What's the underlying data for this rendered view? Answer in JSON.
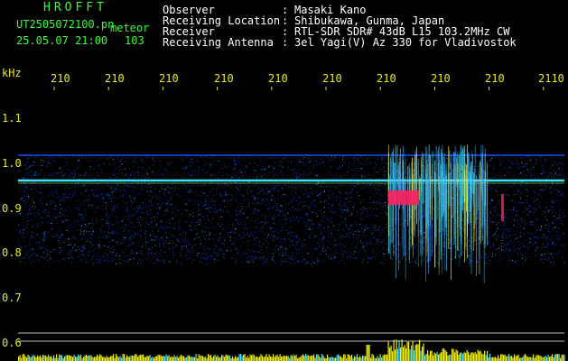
{
  "header": {
    "logo": "HROFFT",
    "filename": "UT2505072100.pn",
    "mode_label": "meteor",
    "datetime": "25.05.07 21:00",
    "count": "103",
    "info": [
      {
        "label": "Observer",
        "value": "Masaki Kano"
      },
      {
        "label": "Receiving Location",
        "value": "Shibukawa, Gunma, Japan"
      },
      {
        "label": "Receiver",
        "value": "RTL-SDR SDR# 43dB L15 103.2MHz CW"
      },
      {
        "label": "Receiving Antenna",
        "value": "3el Yagi(V) Az 330 for Vladivostok"
      }
    ]
  },
  "axes": {
    "y_unit": "kHz",
    "y_ticks": [
      "1.1",
      "1.0",
      "0.9",
      "0.8",
      "0.7",
      "0.6"
    ],
    "x_ticks": [
      "210",
      "210",
      "210",
      "210",
      "210",
      "210",
      "210",
      "210",
      "210",
      "2110"
    ]
  },
  "colors": {
    "text_green": "#33ff33",
    "text_white": "#ffffff",
    "tick_yellow": "#e8e820",
    "signal_blue": "#1a50ff",
    "signal_cyan": "#40e0ff",
    "signal_red": "#ff2060",
    "activity_yellow": "#f0f000"
  }
}
